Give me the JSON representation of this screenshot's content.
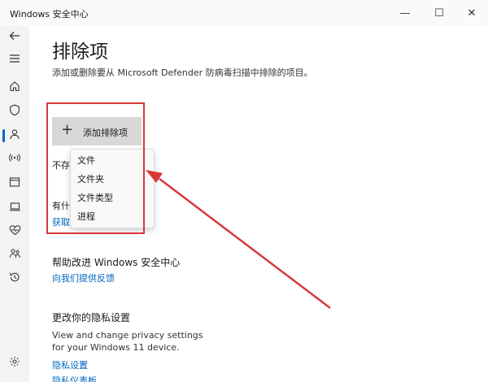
{
  "window": {
    "title": "Windows 安全中心",
    "controls": {
      "minimize": "—",
      "maximize": "☐",
      "close": "✕"
    }
  },
  "sidebar": {
    "icons": [
      "back-icon",
      "menu-icon",
      "home-icon",
      "shield-icon",
      "account-icon",
      "network-icon",
      "app-browser-icon",
      "device-icon",
      "health-icon",
      "family-icon",
      "history-icon",
      "settings-icon"
    ],
    "active": "shield-icon",
    "accent": "#0067c0"
  },
  "page": {
    "title": "排除项",
    "description": "添加或删除要从 Microsoft Defender 防病毒扫描中排除的项目。"
  },
  "add_button": {
    "plus": "+",
    "label": "添加排除项"
  },
  "partial_texts": {
    "no_items": "不存",
    "question": "有什",
    "get_link": "获取"
  },
  "dropdown": {
    "items": [
      "文件",
      "文件夹",
      "文件类型",
      "进程"
    ]
  },
  "improve": {
    "title": "帮助改进 Windows 安全中心",
    "feedback_link": "向我们提供反馈"
  },
  "privacy": {
    "title": "更改你的隐私设置",
    "text_line1": "View and change privacy settings",
    "text_line2": "for your Windows 11 device.",
    "settings_link": "隐私设置",
    "dashboard_link": "隐私仪表板"
  },
  "annotation": {
    "highlight_color": "#d9383a"
  }
}
